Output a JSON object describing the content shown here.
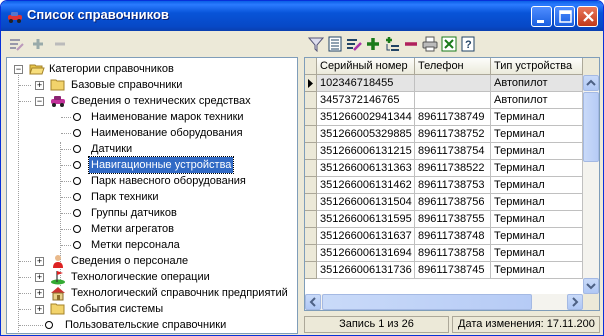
{
  "window": {
    "title": "Список справочников",
    "icon": "cars-icon",
    "controls": [
      "minimize-icon",
      "maximize-icon",
      "close-icon"
    ]
  },
  "left_toolbar": {
    "tools": [
      "edit-icon",
      "add-icon",
      "remove-icon"
    ]
  },
  "tree": {
    "root": "Категории справочников",
    "items": [
      {
        "label": "Базовые справочники",
        "icon": "folder-icon",
        "level": 1,
        "expander": "+"
      },
      {
        "label": "Сведения о технических средствах",
        "icon": "car-icon",
        "level": 1,
        "expander": "-"
      },
      {
        "label": "Наименование марок техники",
        "level": 2
      },
      {
        "label": "Наименование оборудования",
        "level": 2
      },
      {
        "label": "Датчики",
        "level": 2
      },
      {
        "label": "Навигационные устройства",
        "level": 2,
        "selected": true
      },
      {
        "label": "Парк навесного оборудования",
        "level": 2
      },
      {
        "label": "Парк техники",
        "level": 2
      },
      {
        "label": "Группы датчиков",
        "level": 2
      },
      {
        "label": "Метки агрегатов",
        "level": 2
      },
      {
        "label": "Метки персонала",
        "level": 2
      },
      {
        "label": "Сведения о персонале",
        "icon": "person-icon",
        "level": 1,
        "expander": "+"
      },
      {
        "label": "Технологические операции",
        "icon": "golf-flag-icon",
        "level": 1,
        "expander": "+"
      },
      {
        "label": "Технологический справочник предприятий",
        "icon": "house-icon",
        "level": 1,
        "expander": "+"
      },
      {
        "label": "События системы",
        "icon": "folder-icon",
        "level": 1,
        "expander": "+"
      },
      {
        "label": "Пользовательские справочники",
        "level": 1
      }
    ]
  },
  "right_toolbar": {
    "tools": [
      "filter-icon",
      "table-icon",
      "edit-icon",
      "add-icon",
      "add-child-icon",
      "remove-icon",
      "print-icon",
      "export-icon",
      "help-icon"
    ]
  },
  "grid": {
    "columns": [
      "Серийный номер",
      "Телефон",
      "Тип устройства"
    ],
    "rows": [
      [
        "102346718455",
        "",
        "Автопилот"
      ],
      [
        "3457372146765",
        "",
        "Автопилот"
      ],
      [
        "351266002941344",
        "89611738749",
        "Терминал"
      ],
      [
        "351266005329885",
        "89611738752",
        "Терминал"
      ],
      [
        "351266006131215",
        "89611738754",
        "Терминал"
      ],
      [
        "351266006131363",
        "89611738522",
        "Терминал"
      ],
      [
        "351266006131462",
        "89611738753",
        "Терминал"
      ],
      [
        "351266006131504",
        "89611738756",
        "Терминал"
      ],
      [
        "351266006131595",
        "89611738755",
        "Терминал"
      ],
      [
        "351266006131637",
        "89611738748",
        "Терминал"
      ],
      [
        "351266006131694",
        "89611738758",
        "Терминал"
      ],
      [
        "351266006131736",
        "89611738745",
        "Терминал"
      ]
    ]
  },
  "status": {
    "record": "Запись 1 из 26",
    "modified": "Дата изменения: 17.11.200"
  },
  "colors": {
    "titlebar": "#0854d8",
    "selection": "#316ac5",
    "window_bg": "#ece9d8"
  }
}
